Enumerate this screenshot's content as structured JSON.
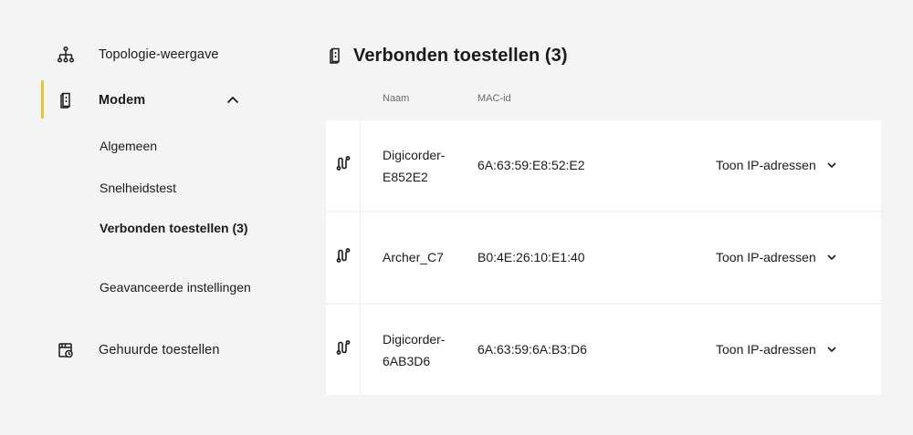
{
  "sidebar": {
    "items": [
      {
        "label": "Topologie-weergave",
        "icon": "topology-icon"
      },
      {
        "label": "Modem",
        "icon": "modem-icon",
        "expanded": true
      },
      {
        "label": "Gehuurde toestellen",
        "icon": "rented-devices-icon"
      }
    ],
    "modem_subitems": [
      {
        "label": "Algemeen"
      },
      {
        "label": "Snelheidstest"
      },
      {
        "label": "Verbonden toestellen (3)",
        "active": true
      },
      {
        "label": "Geavanceerde instellingen"
      }
    ]
  },
  "main": {
    "title": "Verbonden toestellen (3)",
    "columns": {
      "name": "Naam",
      "mac": "MAC-id"
    },
    "devices": [
      {
        "name": "Digicorder-E852E2",
        "mac": "6A:63:59:E8:52:E2",
        "action": "Toon IP-adressen"
      },
      {
        "name": "Archer_C7",
        "mac": "B0:4E:26:10:E1:40",
        "action": "Toon IP-adressen"
      },
      {
        "name": "Digicorder-6AB3D6",
        "mac": "6A:63:59:6A:B3:D6",
        "action": "Toon IP-adressen"
      }
    ]
  },
  "colors": {
    "accent": "#f2c12e",
    "background": "#f4f4f4",
    "card": "#ffffff",
    "text": "#1b1b1b",
    "muted": "#6b6b6b"
  }
}
